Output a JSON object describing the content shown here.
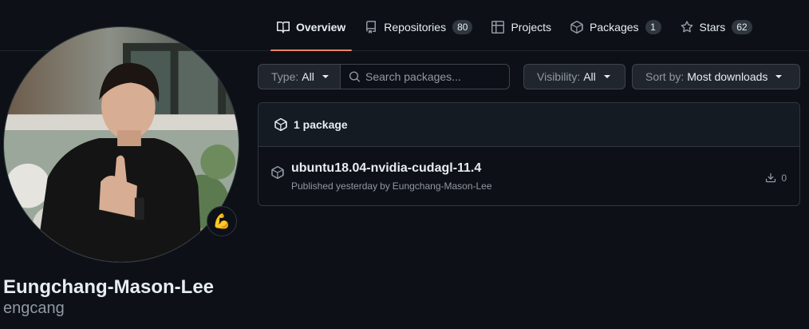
{
  "tabs": [
    {
      "label": "Overview",
      "icon": "book-icon",
      "selected": true
    },
    {
      "label": "Repositories",
      "icon": "repo-icon",
      "count": "80"
    },
    {
      "label": "Projects",
      "icon": "table-icon"
    },
    {
      "label": "Packages",
      "icon": "package-icon",
      "count": "1"
    },
    {
      "label": "Stars",
      "icon": "star-icon",
      "count": "62"
    }
  ],
  "profile": {
    "full_name": "Eungchang-Mason-Lee",
    "username": "engcang",
    "status_emoji": "💪"
  },
  "filters": {
    "type_label": "Type:",
    "type_value": "All",
    "search_placeholder": "Search packages...",
    "visibility_label": "Visibility:",
    "visibility_value": "All",
    "sort_label": "Sort by:",
    "sort_value": "Most downloads"
  },
  "packages": {
    "header": "1 package",
    "items": [
      {
        "name": "ubuntu18.04-nvidia-cudagl-11.4",
        "published": "Published yesterday",
        "by": "by",
        "author": "Eungchang-Mason-Lee",
        "downloads": "0"
      }
    ]
  },
  "colors": {
    "background": "#0d1117",
    "accent_underline": "#f78166",
    "border": "#30363d"
  }
}
